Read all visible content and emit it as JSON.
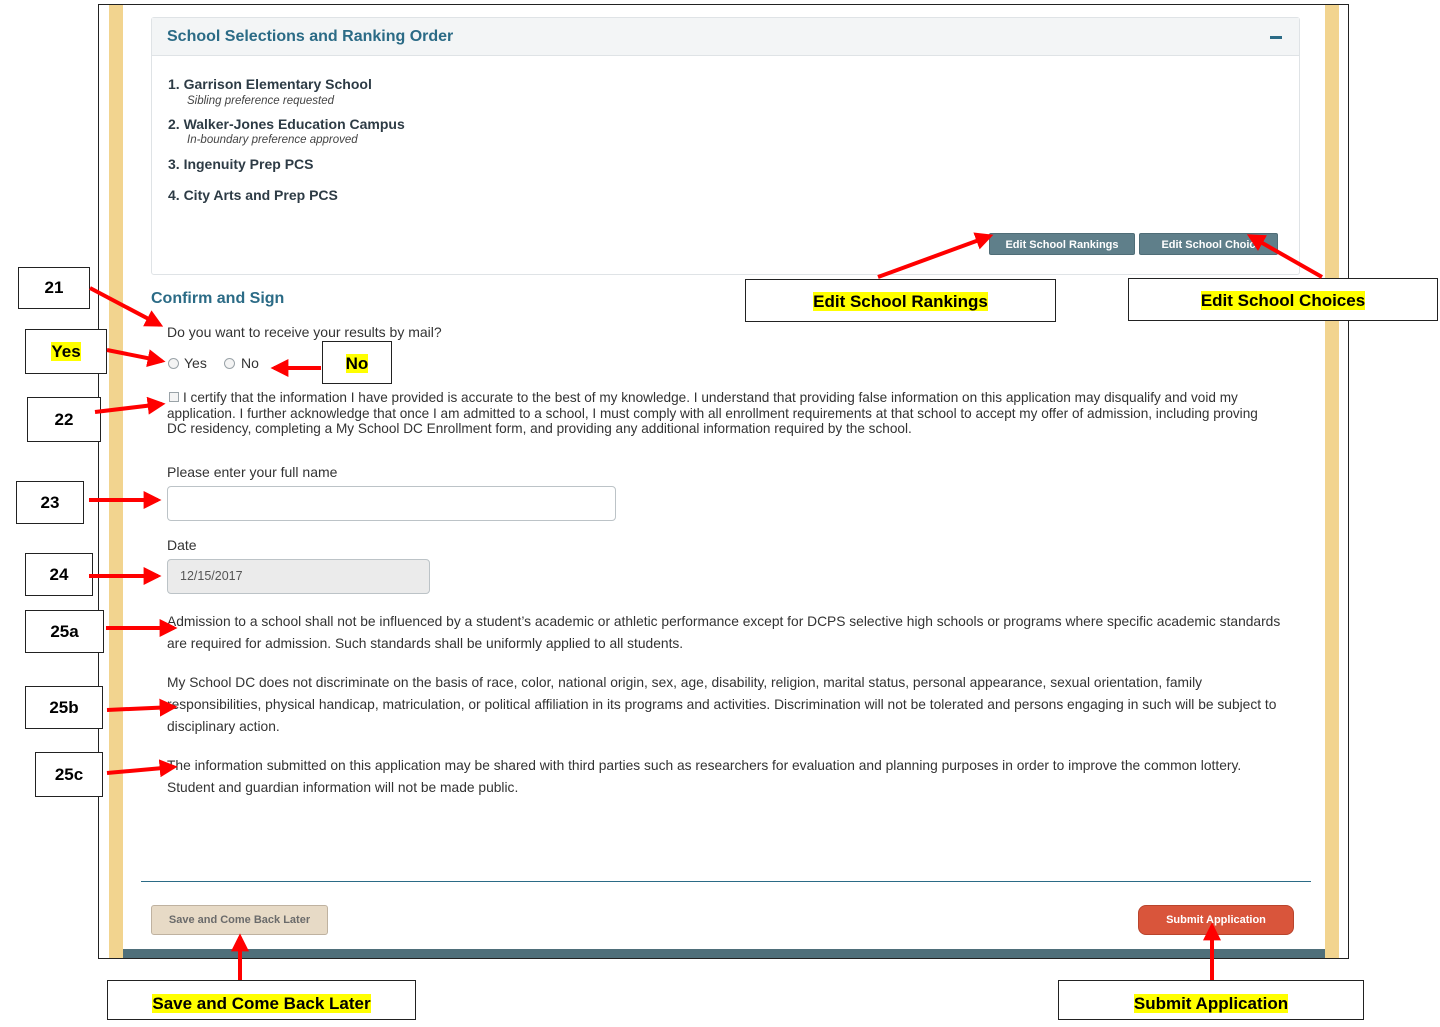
{
  "school_panel": {
    "title": "School Selections and Ranking Order",
    "schools": [
      {
        "label": "1. Garrison Elementary School",
        "note": "Sibling preference requested"
      },
      {
        "label": "2. Walker-Jones Education Campus",
        "note": "In-boundary preference approved"
      },
      {
        "label": "3. Ingenuity Prep PCS",
        "note": ""
      },
      {
        "label": "4. City Arts and Prep PCS",
        "note": ""
      }
    ],
    "edit_rankings_label": "Edit School Rankings",
    "edit_choices_label": "Edit School Choic"
  },
  "confirm": {
    "title": "Confirm and Sign",
    "mail_question": "Do you want to receive your results by mail?",
    "yes_label": "Yes",
    "no_label": "No",
    "certify_text": "I certify that the information I have provided is accurate to the best of my knowledge. I understand that providing false information on this application may disqualify and void my application. I further acknowledge that once I am admitted to a school, I must comply with all enrollment requirements at that school to accept my offer of admission, including proving DC residency, completing a My School DC Enrollment form, and providing any additional information required by the school.",
    "name_label": "Please enter your full name",
    "name_value": "",
    "date_label": "Date",
    "date_value": "12/15/2017"
  },
  "notices": {
    "admission": "Admission to a school shall not be influenced by a student’s academic or athletic performance except for DCPS selective high schools or programs where specific academic standards are required for admission. Such standards shall be uniformly applied to all students.",
    "nondiscrimination": "My School DC does not discriminate on the basis of race, color, national origin, sex, age, disability, religion, marital status, personal appearance, sexual orientation, family responsibilities, physical handicap, matriculation, or political affiliation in its programs and activities. Discrimination will not be tolerated and persons engaging in such will be subject to disciplinary action.",
    "sharing": "The information submitted on this application may be shared with third parties such as researchers for evaluation and planning purposes in order to improve the common lottery. Student and guardian information will not be made public."
  },
  "footer": {
    "save_label": "Save and Come Back Later",
    "submit_label": "Submit Application"
  },
  "callouts": {
    "c21": "21",
    "yes": "Yes",
    "no": "No",
    "c22": "22",
    "c23": "23",
    "c24": "24",
    "c25a": "25a",
    "c25b": "25b",
    "c25c": "25c",
    "edit_rankings": "Edit School Rankings",
    "edit_choices": "Edit School Choices",
    "save": "Save and Come Back Later",
    "submit": "Submit Application"
  },
  "colors": {
    "accent": "#2b6b86",
    "gold_border": "#f2d48f",
    "submit": "#d9553b",
    "panel_button": "#5f7f8a",
    "arrow": "#ff0000",
    "highlight": "#ffff00"
  }
}
